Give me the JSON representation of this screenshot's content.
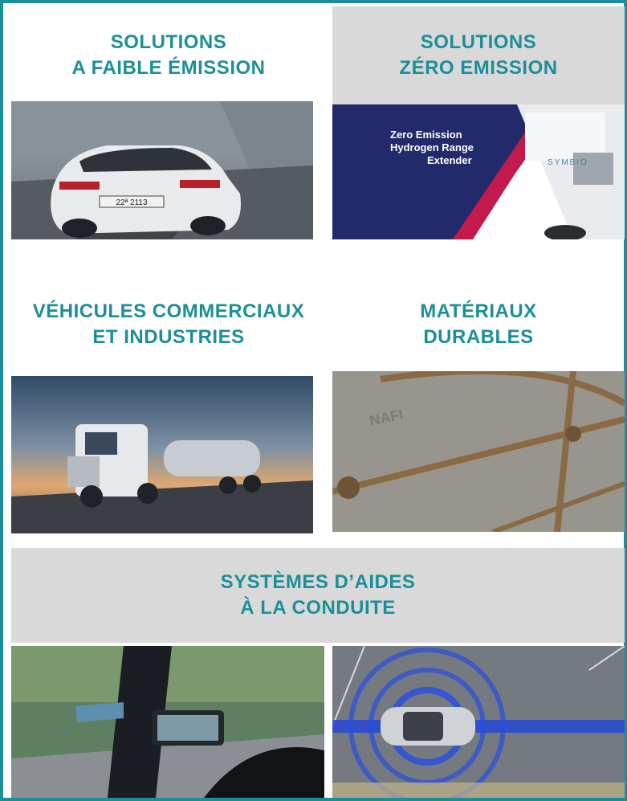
{
  "sections": {
    "low_emission": {
      "line1": "SOLUTIONS",
      "line2": "A FAIBLE ÉMISSION"
    },
    "zero_emission": {
      "line1": "SOLUTIONS",
      "line2": "ZÉRO EMISSION"
    },
    "commercial": {
      "line1": "VÉHICULES COMMERCIAUX",
      "line2": "ET INDUSTRIES"
    },
    "materials": {
      "line1": "MATÉRIAUX",
      "line2": "DURABLES"
    },
    "driving_aids": {
      "line1": "SYSTÈMES D’AIDES",
      "line2": "À LA CONDUITE"
    }
  },
  "photos": {
    "van_text_line1": "Zero Emission",
    "van_text_line2": "Hydrogen Range",
    "van_text_line3": "Extender",
    "van_brand": "SYMBIO",
    "plate": "22ª 2113",
    "naf_logo": "NAFI"
  },
  "colors": {
    "accent": "#1b8f99",
    "grey_band": "#d9d9d9"
  }
}
